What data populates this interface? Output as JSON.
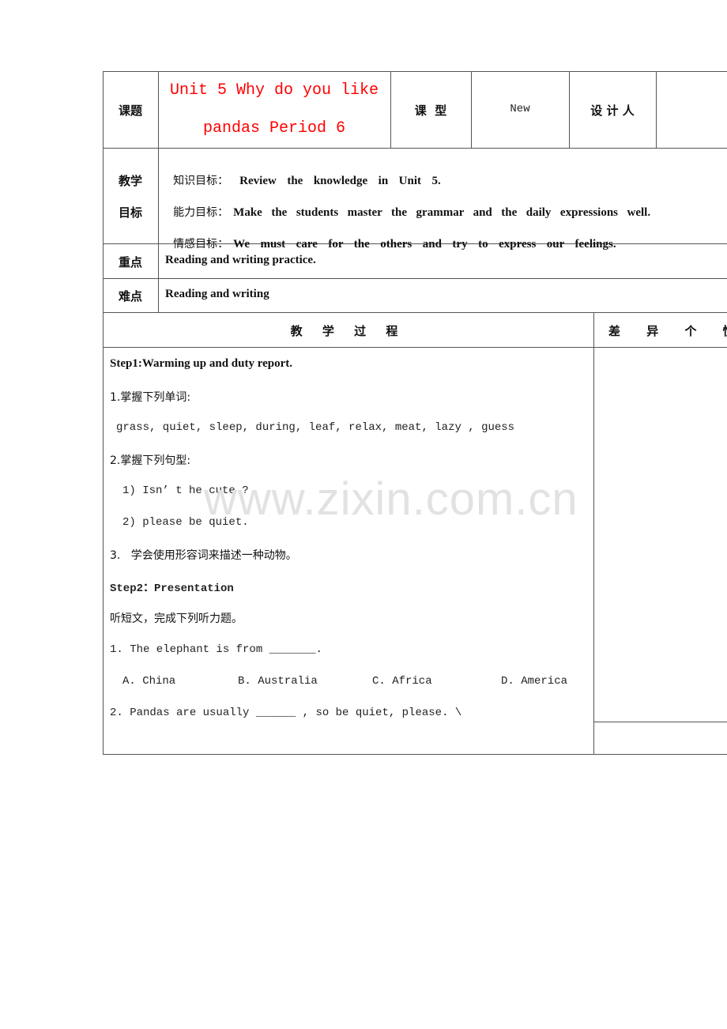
{
  "header_row": {
    "topic_label": "课题",
    "topic_value_line1": "Unit 5 Why do you like",
    "topic_value_line2": "pandas Period 6",
    "type_label": "课  型",
    "type_value": "New",
    "designer_label": "设 计 人",
    "designer_value": ""
  },
  "objectives": {
    "label_line1": "教学",
    "label_line2": "目标",
    "items": [
      {
        "label": "知识目标：",
        "text": "Review  the  knowledge  in  Unit  5."
      },
      {
        "label": "能力目标：",
        "text": "Make  the  students  master  the  grammar  and  the  daily  expressions  well."
      },
      {
        "label": "情感目标：",
        "text": "We  must  care  for  the  others  and  try  to  express  our  feelings."
      }
    ]
  },
  "key_point": {
    "label": "重点",
    "text": "Reading and writing practice."
  },
  "difficult_point": {
    "label": "难点",
    "text": "Reading and writing"
  },
  "process_header": {
    "left": "教 学 过 程",
    "right": "差 异 个 性"
  },
  "process": {
    "step1_title": "Step1:Warming up and duty report.",
    "item1_title": "1.掌握下列单词:",
    "item1_words": "grass, quiet, sleep, during, leaf, relax, meat, lazy , guess",
    "item2_title": "2.掌握下列句型:",
    "item2_sentences": [
      "1) Isn’ t he cute ?",
      "2) please be quiet."
    ],
    "item3": "3.   学会使用形容词来描述一种动物。",
    "step2_title": "Step2：Presentation",
    "listening_intro": "听短文，完成下列听力题。",
    "q1": "1. The elephant is from _______.",
    "q1_options": [
      "A. China",
      "B. Australia",
      "C. Africa",
      "D. America"
    ],
    "q2": "2. Pandas are usually ______ , so be quiet, please. \\"
  },
  "watermark": "www.zixin.com.cn"
}
